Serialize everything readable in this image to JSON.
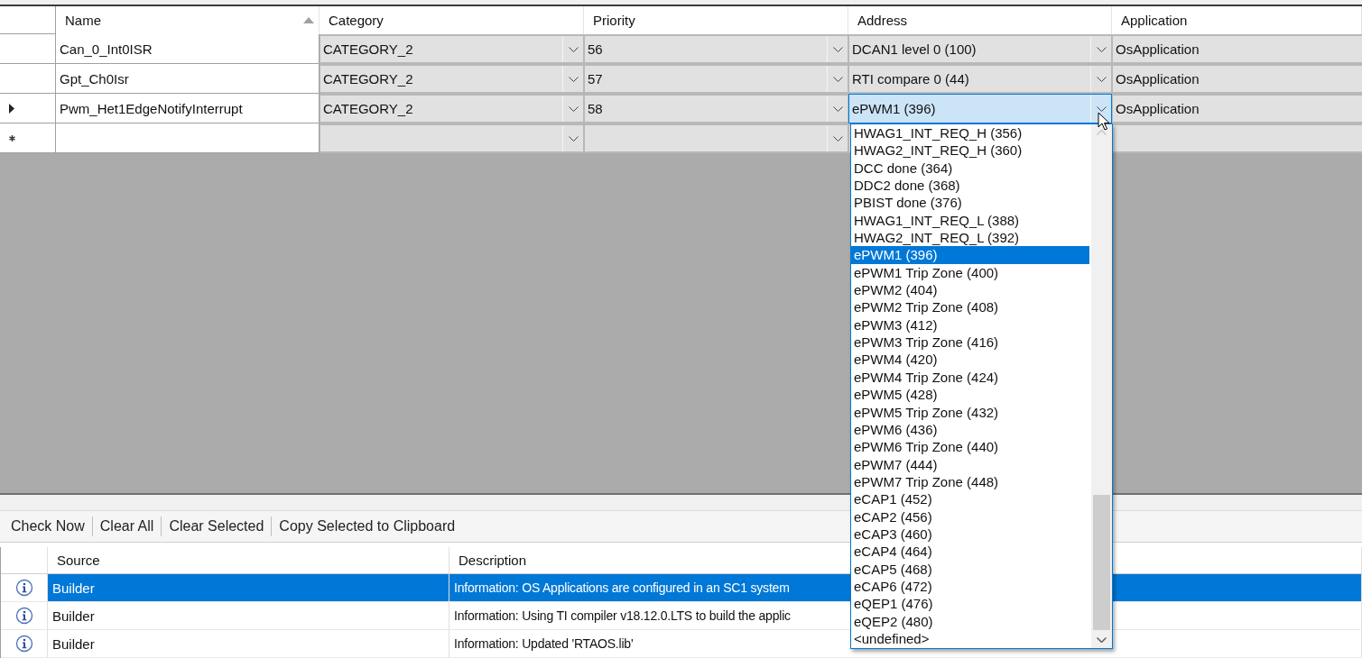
{
  "grid": {
    "columns": [
      {
        "label": "Name",
        "sorted": true
      },
      {
        "label": "Category",
        "sorted": false
      },
      {
        "label": "Priority",
        "sorted": false
      },
      {
        "label": "Address",
        "sorted": false
      },
      {
        "label": "Application",
        "sorted": false
      }
    ],
    "rows": [
      {
        "kind": "data",
        "current": false,
        "name": "Can_0_Int0ISR",
        "category": "CATEGORY_2",
        "priority": "56",
        "address": "DCAN1 level 0 (100)",
        "address_editing": false,
        "application": "OsApplication"
      },
      {
        "kind": "data",
        "current": false,
        "name": "Gpt_Ch0Isr",
        "category": "CATEGORY_2",
        "priority": "57",
        "address": "RTI compare 0 (44)",
        "address_editing": false,
        "application": "OsApplication"
      },
      {
        "kind": "data",
        "current": true,
        "name": "Pwm_Het1EdgeNotifyInterrupt",
        "category": "CATEGORY_2",
        "priority": "58",
        "address": "ePWM1 (396)",
        "address_editing": true,
        "application": "OsApplication"
      },
      {
        "kind": "new",
        "current": false
      }
    ]
  },
  "dropdown": {
    "items": [
      {
        "label": "HWAG1_INT_REQ_H (356)",
        "selected": false
      },
      {
        "label": "HWAG2_INT_REQ_H (360)",
        "selected": false
      },
      {
        "label": "DCC done (364)",
        "selected": false
      },
      {
        "label": "DDC2 done (368)",
        "selected": false
      },
      {
        "label": "PBIST done (376)",
        "selected": false
      },
      {
        "label": "HWAG1_INT_REQ_L (388)",
        "selected": false
      },
      {
        "label": "HWAG2_INT_REQ_L (392)",
        "selected": false
      },
      {
        "label": "ePWM1 (396)",
        "selected": true
      },
      {
        "label": "ePWM1 Trip Zone (400)",
        "selected": false
      },
      {
        "label": "ePWM2 (404)",
        "selected": false
      },
      {
        "label": "ePWM2 Trip Zone (408)",
        "selected": false
      },
      {
        "label": "ePWM3 (412)",
        "selected": false
      },
      {
        "label": "ePWM3 Trip Zone (416)",
        "selected": false
      },
      {
        "label": "ePWM4 (420)",
        "selected": false
      },
      {
        "label": "ePWM4 Trip Zone (424)",
        "selected": false
      },
      {
        "label": "ePWM5 (428)",
        "selected": false
      },
      {
        "label": "ePWM5 Trip Zone (432)",
        "selected": false
      },
      {
        "label": "ePWM6 (436)",
        "selected": false
      },
      {
        "label": "ePWM6 Trip Zone (440)",
        "selected": false
      },
      {
        "label": "ePWM7 (444)",
        "selected": false
      },
      {
        "label": "ePWM7 Trip Zone (448)",
        "selected": false
      },
      {
        "label": "eCAP1 (452)",
        "selected": false
      },
      {
        "label": "eCAP2 (456)",
        "selected": false
      },
      {
        "label": "eCAP3 (460)",
        "selected": false
      },
      {
        "label": "eCAP4 (464)",
        "selected": false
      },
      {
        "label": "eCAP5 (468)",
        "selected": false
      },
      {
        "label": "eCAP6 (472)",
        "selected": false
      },
      {
        "label": "eQEP1 (476)",
        "selected": false
      },
      {
        "label": "eQEP2 (480)",
        "selected": false
      },
      {
        "label": "<undefined>",
        "selected": false
      }
    ]
  },
  "toolbar": {
    "buttons": [
      "Check Now",
      "Clear All",
      "Clear Selected",
      "Copy Selected to Clipboard"
    ]
  },
  "messages": {
    "columns": [
      "Source",
      "Description"
    ],
    "rows": [
      {
        "kind": "info",
        "source": "Builder",
        "description": "Information: OS Applications are configured in an SC1 system",
        "selected": true
      },
      {
        "kind": "info",
        "source": "Builder",
        "description": "Information: Using TI compiler v18.12.0.LTS to build the applic",
        "selected": false
      },
      {
        "kind": "info",
        "source": "Builder",
        "description": "Information: Updated 'RTAOS.lib'",
        "selected": false
      }
    ]
  }
}
